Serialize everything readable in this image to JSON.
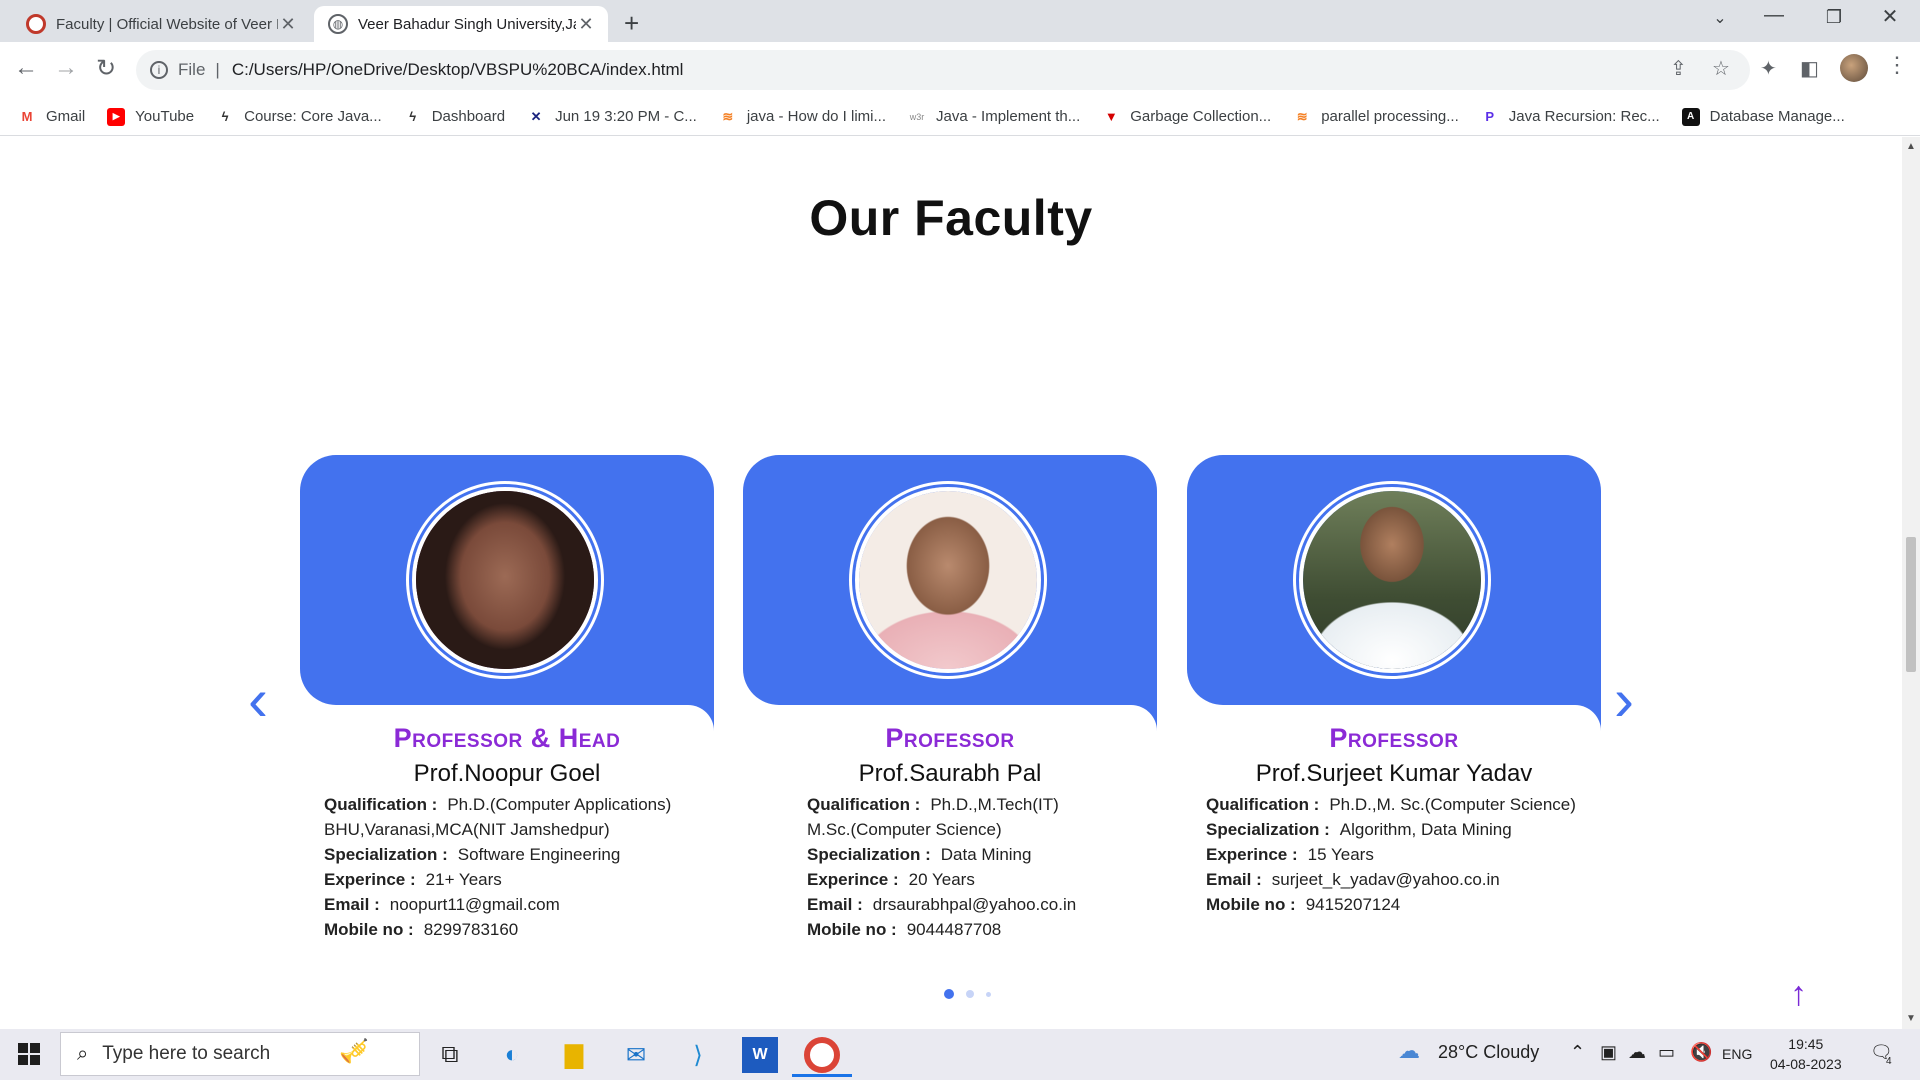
{
  "browser": {
    "tabs": [
      {
        "title": "Faculty | Official Website of Veer Bahadur Singh",
        "active": false
      },
      {
        "title": "Veer Bahadur Singh University,Jaunpur",
        "active": true
      }
    ],
    "url_scheme": "File",
    "url": "C:/Users/HP/OneDrive/Desktop/VBSPU%20BCA/index.html",
    "bookmarks": [
      {
        "label": "Gmail",
        "icon": "gmail-icon"
      },
      {
        "label": "YouTube",
        "icon": "youtube-icon"
      },
      {
        "label": "Course: Core Java...",
        "icon": "course-icon"
      },
      {
        "label": "Dashboard",
        "icon": "dashboard-icon"
      },
      {
        "label": "Jun 19 3:20 PM - C...",
        "icon": "meet-icon"
      },
      {
        "label": "java - How do I limi...",
        "icon": "stackoverflow-icon"
      },
      {
        "label": "Java - Implement th...",
        "icon": "w3r-icon"
      },
      {
        "label": "Garbage Collection...",
        "icon": "garbage-icon"
      },
      {
        "label": "parallel processing...",
        "icon": "stackoverflow-icon"
      },
      {
        "label": "Java Recursion: Rec...",
        "icon": "p-icon"
      },
      {
        "label": "Database Manage...",
        "icon": "db-icon"
      }
    ]
  },
  "page": {
    "heading": "Our Faculty",
    "faculty": [
      {
        "role": "Professor & Head",
        "name": "Prof.Noopur Goel",
        "qualification_label": "Qualification :",
        "qualification": "Ph.D.(Computer Applications)",
        "qualification_cont": "BHU,Varanasi,MCA(NIT Jamshedpur)",
        "specialization_label": "Specialization :",
        "specialization": "Software Engineering",
        "experience_label": "Experince :",
        "experience": "21+ Years",
        "email_label": "Email :",
        "email": "noopurt11@gmail.com",
        "mobile_label": "Mobile no :",
        "mobile": "8299783160"
      },
      {
        "role": "Professor",
        "name": "Prof.Saurabh Pal",
        "qualification_label": "Qualification :",
        "qualification": "Ph.D.,M.Tech(IT)",
        "qualification_cont": "M.Sc.(Computer Science)",
        "specialization_label": "Specialization :",
        "specialization": "Data Mining",
        "experience_label": "Experince :",
        "experience": "20 Years",
        "email_label": "Email :",
        "email": "drsaurabhpal@yahoo.co.in",
        "mobile_label": "Mobile no :",
        "mobile": "9044487708"
      },
      {
        "role": "Professor",
        "name": "Prof.Surjeet Kumar Yadav",
        "qualification_label": "Qualification :",
        "qualification": "Ph.D.,M. Sc.(Computer Science)",
        "qualification_cont": "",
        "specialization_label": "Specialization :",
        "specialization": "Algorithm, Data Mining",
        "experience_label": "Experince :",
        "experience": "15 Years",
        "email_label": "Email :",
        "email": "surjeet_k_yadav@yahoo.co.in",
        "mobile_label": "Mobile no :",
        "mobile": "9415207124"
      }
    ],
    "carousel": {
      "pages": 3,
      "active_page": 1
    },
    "colors": {
      "card_blue": "#4372ee",
      "role_purple": "#8b2ad6"
    }
  },
  "taskbar": {
    "search_placeholder": "Type here to search",
    "weather": "28°C  Cloudy",
    "language": "ENG",
    "time": "19:45",
    "date": "04-08-2023",
    "notifications": "4"
  }
}
